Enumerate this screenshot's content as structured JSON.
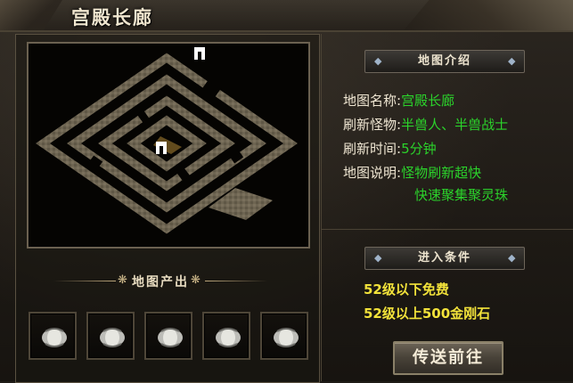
{
  "window": {
    "title": "宫殿长廊"
  },
  "drops": {
    "title": "地图产出",
    "items": [
      {
        "icon": "silver-ore-icon"
      },
      {
        "icon": "silver-ore-icon"
      },
      {
        "icon": "silver-ore-icon"
      },
      {
        "icon": "silver-ore-icon"
      },
      {
        "icon": "silver-ore-icon"
      }
    ]
  },
  "intro": {
    "header": "地图介绍",
    "name_label": "地图名称:",
    "name_value": "宫殿长廊",
    "monster_label": "刷新怪物:",
    "monster_value": "半兽人、半兽战士",
    "time_label": "刷新时间:",
    "time_value": "5分钟",
    "desc_label": "地图说明:",
    "desc_line1": "怪物刷新超快",
    "desc_line2": "快速聚集聚灵珠"
  },
  "requirements": {
    "header": "进入条件",
    "line1": "52级以下免费",
    "line2": "52级以上500金刚石"
  },
  "teleport": {
    "label": "传送前往"
  },
  "colors": {
    "value_green": "#2bd32b",
    "requirement_yellow": "#f2e23a",
    "label_cream": "#efe6d2"
  }
}
